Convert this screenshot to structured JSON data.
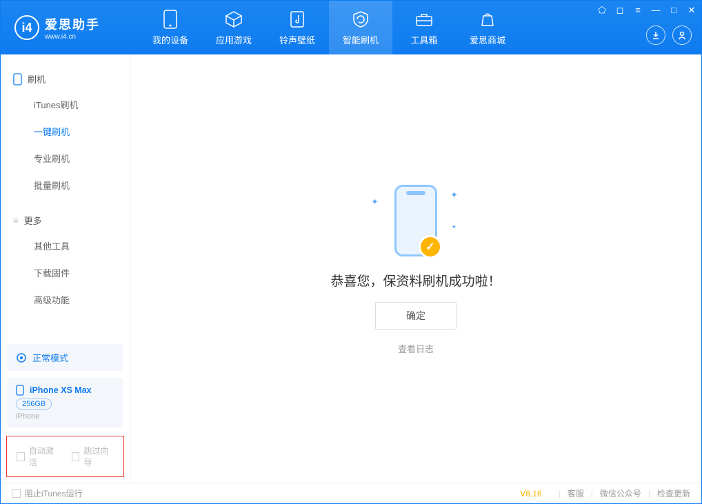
{
  "app": {
    "name": "爱思助手",
    "site": "www.i4.cn"
  },
  "nav": {
    "tabs": [
      {
        "label": "我的设备",
        "icon": "device"
      },
      {
        "label": "应用游戏",
        "icon": "cube"
      },
      {
        "label": "铃声壁纸",
        "icon": "music"
      },
      {
        "label": "智能刷机",
        "icon": "refresh"
      },
      {
        "label": "工具箱",
        "icon": "toolbox"
      },
      {
        "label": "爱思商城",
        "icon": "shop"
      }
    ],
    "active_index": 3
  },
  "sidebar": {
    "sections": [
      {
        "title": "刷机",
        "items": [
          "iTunes刷机",
          "一键刷机",
          "专业刷机",
          "批量刷机"
        ],
        "active_index": 1
      },
      {
        "title": "更多",
        "items": [
          "其他工具",
          "下载固件",
          "高级功能"
        ],
        "active_index": -1
      }
    ],
    "mode_label": "正常模式",
    "device": {
      "name": "iPhone XS Max",
      "storage": "256GB",
      "type": "iPhone"
    },
    "options": {
      "auto_activate": "自动激活",
      "skip_guide": "跳过向导"
    }
  },
  "main": {
    "success_text": "恭喜您，保资料刷机成功啦！",
    "ok_button": "确定",
    "view_log": "查看日志"
  },
  "footer": {
    "block_itunes": "阻止iTunes运行",
    "version": "V8.16",
    "links": [
      "客服",
      "微信公众号",
      "检查更新"
    ]
  }
}
